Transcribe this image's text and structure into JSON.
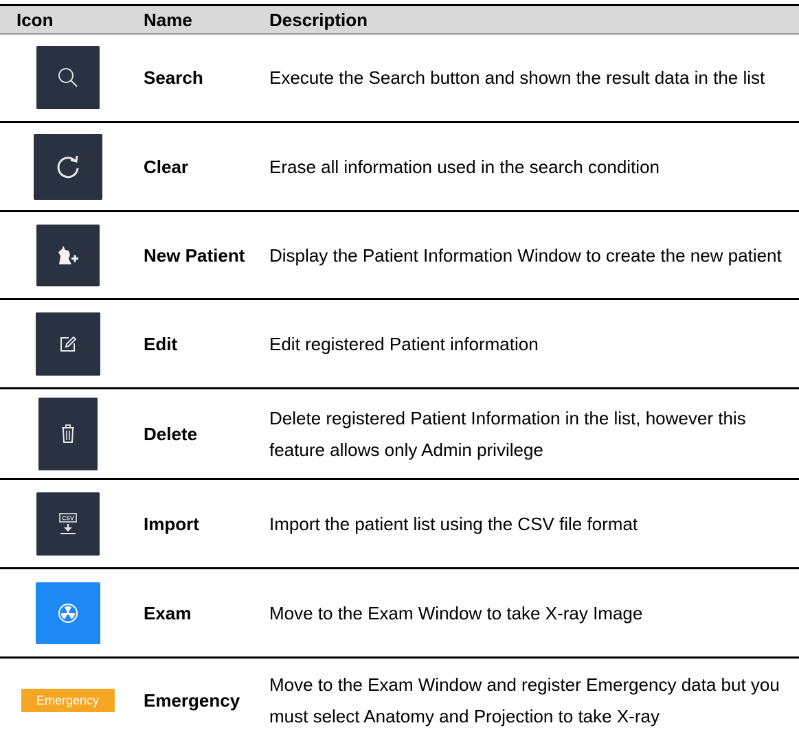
{
  "header": {
    "icon": "Icon",
    "name": "Name",
    "description": "Description"
  },
  "rows": [
    {
      "icon": "search-icon",
      "name": "Search",
      "description": "Execute the Search button and shown the result data in the list"
    },
    {
      "icon": "refresh-icon",
      "name": "Clear",
      "description": "Erase all information used in the search condition"
    },
    {
      "icon": "new-patient-icon",
      "name": "New Patient",
      "description": "Display the Patient Information Window to create the new patient"
    },
    {
      "icon": "edit-icon",
      "name": "Edit",
      "description": "Edit registered Patient information"
    },
    {
      "icon": "trash-icon",
      "name": "Delete",
      "description": "Delete registered Patient Information in the list, however this feature allows only Admin privilege"
    },
    {
      "icon": "csv-import-icon",
      "icon_text": "CSV",
      "name": "Import",
      "description": "Import the patient list using the CSV file format"
    },
    {
      "icon": "radiation-icon",
      "name": "Exam",
      "description": "Move to the Exam Window to take X-ray Image"
    },
    {
      "icon": "emergency-button-icon",
      "icon_text": "Emergency",
      "name": "Emergency",
      "description": "Move to the Exam Window and register Emergency data but you must select Anatomy and Projection to take X-ray"
    }
  ],
  "colors": {
    "icon_bg": "#2a3241",
    "exam_bg": "#1e88f5",
    "emergency_bg": "#f5a623",
    "header_bg": "#d9d9d9"
  }
}
